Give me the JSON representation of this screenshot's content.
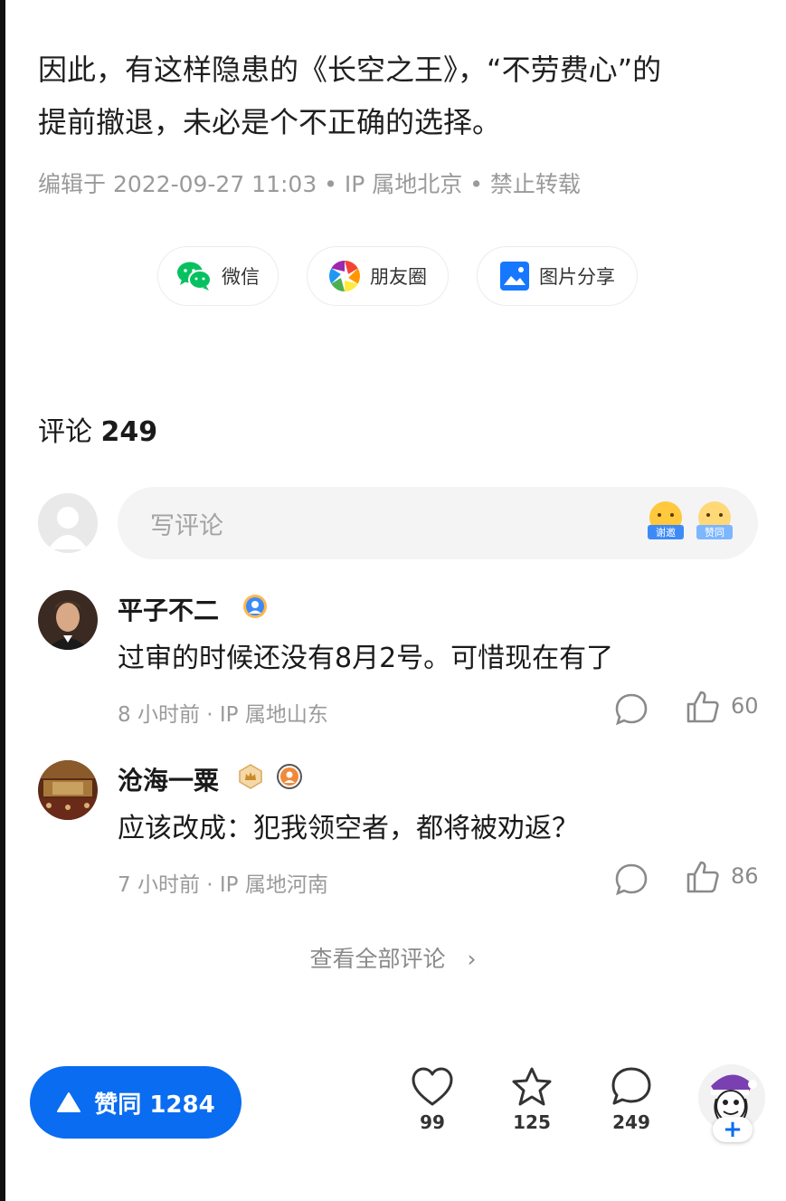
{
  "article": {
    "line1": "因此，有这样隐患的《长空之王》，“不劳费心”的",
    "line2": "提前撤退，未必是个不正确的选择。",
    "meta": "编辑于 2022-09-27 11:03 • IP 属地北京 • 禁止转载"
  },
  "share": {
    "wechat": "微信",
    "moments": "朋友圈",
    "image_share": "图片分享"
  },
  "comments": {
    "heading": "评论",
    "count": "249",
    "input_placeholder": "写评论",
    "emoji_thanks": "谢邀",
    "emoji_agree": "赞同",
    "items": [
      {
        "author": "平子不二",
        "text": "过审的时候还没有8月2号。可惜现在有了",
        "meta": "8 小时前 · IP 属地山东",
        "likes": "60"
      },
      {
        "author": "沧海一粟",
        "text": "应该改成：犯我领空者，都将被劝返？",
        "meta": "7 小时前 · IP 属地河南",
        "likes": "86"
      }
    ],
    "view_all": "查看全部评论",
    "view_all_arrow": "›"
  },
  "bottom_bar": {
    "agree_label": "赞同 1284",
    "like_count": "99",
    "favorite_count": "125",
    "comment_count": "249",
    "follow_plus": "+"
  },
  "colors": {
    "accent": "#0a6cf0",
    "muted_text": "#9a9a9a",
    "input_bg": "#f4f4f5"
  }
}
